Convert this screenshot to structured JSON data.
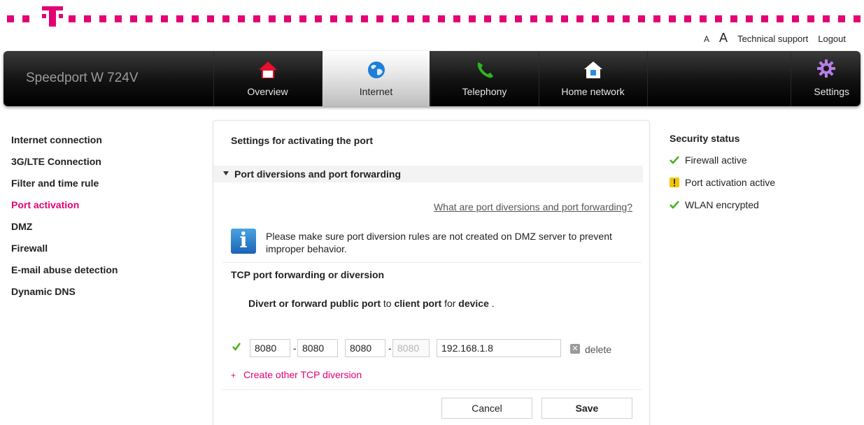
{
  "top_links": {
    "font_small": "A",
    "font_large": "A",
    "support": "Technical support",
    "logout": "Logout"
  },
  "product_name": "Speedport W 724V",
  "nav": {
    "tabs": [
      {
        "label": "Overview",
        "icon": "home-icon"
      },
      {
        "label": "Internet",
        "icon": "globe-icon"
      },
      {
        "label": "Telephony",
        "icon": "phone-icon"
      },
      {
        "label": "Home network",
        "icon": "home-network-icon"
      }
    ],
    "active_tab": "Internet",
    "settings_label": "Settings"
  },
  "left_menu": {
    "items": [
      "Internet connection",
      "3G/LTE Connection",
      "Filter and time rule",
      "Port activation",
      "DMZ",
      "Firewall",
      "E-mail abuse detection",
      "Dynamic DNS"
    ],
    "active_item": "Port activation"
  },
  "panel": {
    "title": "Settings for activating the port",
    "section_head": "Port diversions and port forwarding",
    "help_link": "What are port diversions and port forwarding?",
    "info_icon_glyph": "i",
    "info_text": "Please make sure port diversion rules are not created on DMZ server to prevent improper behavior.",
    "tcp_title": "TCP port forwarding or diversion",
    "sentence": {
      "s1": "Divert or forward",
      "s2": "public port",
      "s3": "to",
      "s4": "client port",
      "s5": "for",
      "s6": "device",
      "s7": "."
    },
    "rule": {
      "enabled": true,
      "public_port_from": "8080",
      "public_port_to": "8080",
      "client_port_from": "8080",
      "client_port_to": "8080",
      "separator": "-",
      "device_ip": "192.168.1.8",
      "delete_label": "delete"
    },
    "create_link": "Create other TCP diversion",
    "cancel_label": "Cancel",
    "save_label": "Save"
  },
  "security": {
    "title": "Security status",
    "items": [
      {
        "label": "Firewall active",
        "status": "ok"
      },
      {
        "label": "Port activation active",
        "status": "warning"
      },
      {
        "label": "WLAN encrypted",
        "status": "ok"
      }
    ]
  },
  "colors": {
    "brand": "#e20074",
    "ok": "#4caf1a",
    "warning": "#f4c400"
  }
}
